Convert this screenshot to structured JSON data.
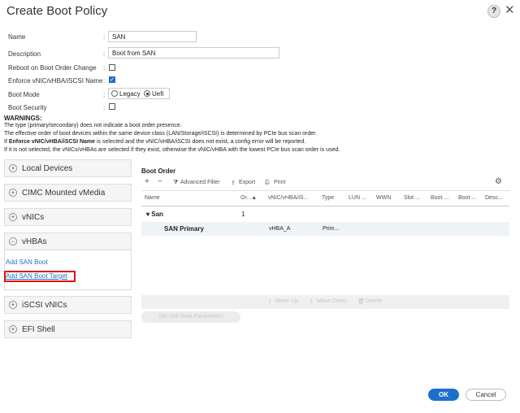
{
  "dialog": {
    "title": "Create Boot Policy",
    "help": "?",
    "close": "✕"
  },
  "form": {
    "name_label": "Name",
    "name_value": "SAN",
    "description_label": "Description",
    "description_value": "Boot from SAN",
    "reboot_label": "Reboot on Boot Order Change",
    "reboot_checked": false,
    "enforce_label": "Enforce vNIC/vHBA/iSCSI Name",
    "enforce_checked": true,
    "boot_mode_label": "Boot Mode",
    "boot_mode_options": [
      "Legacy",
      "Uefi"
    ],
    "boot_mode_selected": "Uefi",
    "boot_security_label": "Boot Security",
    "boot_security_checked": false,
    "colon": ":"
  },
  "warnings": {
    "heading": "WARNINGS:",
    "line1": "The type (primary/secondary) does not indicate a boot order presence.",
    "line2": "The effective order of boot devices within the same device class (LAN/Storage/iSCSI) is determined by PCIe bus scan order.",
    "line3_pre": "If ",
    "line3_bold": "Enforce vNIC/vHBA/iSCSI Name",
    "line3_post": " is selected and the vNIC/vHBA/iSCSI does not exist, a config error will be reported.",
    "line4": "If it is not selected, the vNICs/vHBAs are selected if they exist, otherwise the vNIC/vHBA with the lowest PCIe bus scan order is used."
  },
  "left_panel": {
    "sections": [
      {
        "label": "Local Devices",
        "sign": "+"
      },
      {
        "label": "CIMC Mounted vMedia",
        "sign": "+"
      },
      {
        "label": "vNICs",
        "sign": "+"
      },
      {
        "label": "vHBAs",
        "sign": "−"
      },
      {
        "label": "iSCSI vNICs",
        "sign": "+"
      },
      {
        "label": "EFI Shell",
        "sign": "+"
      }
    ],
    "vhba_links": [
      "Add SAN Boot",
      "Add SAN Boot Target"
    ]
  },
  "boot_order": {
    "title": "Boot Order",
    "toolbar": {
      "add": "+",
      "remove": "−",
      "filter": "Advanced Filter",
      "export": "Export",
      "print": "Print"
    },
    "columns": [
      "Name",
      "Or...",
      "vNIC/vHBA/iS...",
      "Type",
      "LUN ...",
      "WWN",
      "Slot ...",
      "Boot ...",
      "Boot ...",
      "Desc..."
    ],
    "rows": [
      {
        "name": "San",
        "order": "1",
        "vhba": "",
        "type": ""
      },
      {
        "name": "SAN Primary",
        "order": "",
        "vhba": "vHBA_A",
        "type": "Prim..."
      }
    ],
    "actions": {
      "move_up": "Move Up",
      "move_down": "Move Down",
      "delete": "Delete"
    },
    "uefi_button": "Set Uefi Boot Parameters"
  },
  "footer": {
    "ok": "OK",
    "cancel": "Cancel"
  },
  "colors": {
    "accent": "#1d6fcc",
    "highlight_box": "#dd1111"
  }
}
